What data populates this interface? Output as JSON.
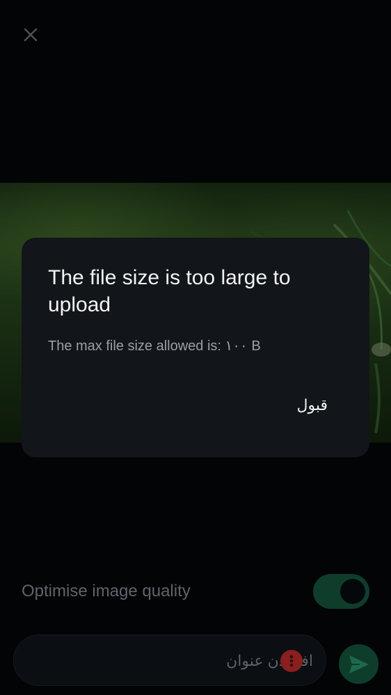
{
  "header": {
    "close_icon": "close-icon"
  },
  "dialog": {
    "title": "The file size is too large to upload",
    "message": "The max file size allowed is: ١٠٠ B",
    "accept_label": "قبول"
  },
  "options": {
    "optimise_label": "Optimise image quality",
    "optimise_enabled": true
  },
  "composer": {
    "caption_placeholder": "افزودن عنوان",
    "error_icon": "error-icon",
    "send_icon": "send-icon"
  },
  "colors": {
    "background": "#05070a",
    "dialog_background": "#121519",
    "accent": "#0f3d2b",
    "error": "#8a1f1f"
  }
}
